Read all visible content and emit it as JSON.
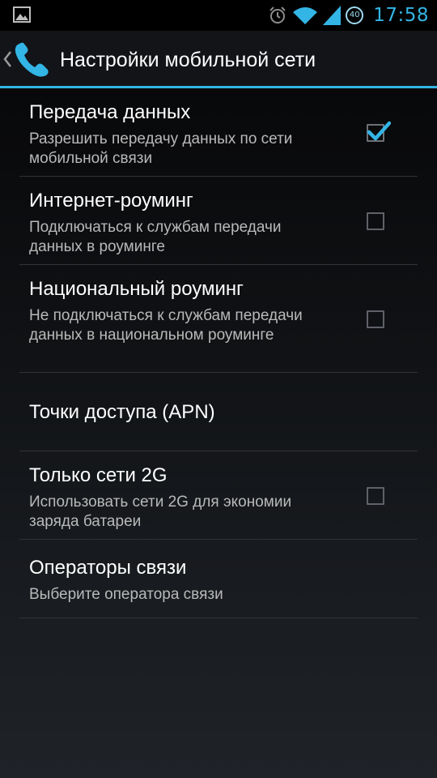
{
  "statusbar": {
    "time": "17:58",
    "badge": "40",
    "icons": [
      "gallery-notification-icon",
      "alarm-icon",
      "wifi-icon",
      "signal-icon",
      "badge-icon"
    ]
  },
  "actionbar": {
    "title": "Настройки мобильной сети",
    "icon": "phone-icon",
    "up_icon": "chevron-left-icon"
  },
  "colors": {
    "accent": "#33b5e5",
    "background": "#000000",
    "summary_text": "#b9b9b9",
    "divider": "#303338"
  },
  "items": [
    {
      "title": "Передача данных",
      "summary": "Разрешить передачу данных по сети мобильной связи",
      "has_checkbox": true,
      "checked": true
    },
    {
      "title": "Интернет-роуминг",
      "summary": "Подключаться к службам передачи данных в роуминге",
      "has_checkbox": true,
      "checked": false
    },
    {
      "title": "Национальный роуминг",
      "summary": "Не подключаться к службам передачи данных в национальном роуминге",
      "has_checkbox": true,
      "checked": false
    },
    {
      "title": "Точки доступа (APN)",
      "summary": "",
      "has_checkbox": false,
      "checked": false
    },
    {
      "title": "Только сети 2G",
      "summary": "Использовать сети 2G для экономии заряда батареи",
      "has_checkbox": true,
      "checked": false
    },
    {
      "title": "Операторы связи",
      "summary": "Выберите оператора связи",
      "has_checkbox": false,
      "checked": false
    }
  ]
}
